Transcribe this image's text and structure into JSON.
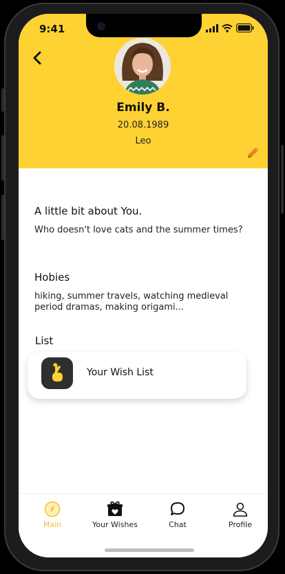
{
  "status_bar": {
    "time": "9:41"
  },
  "profile": {
    "name": "Emily B.",
    "dob": "20.08.1989",
    "sign": "Leo"
  },
  "about": {
    "title": "A little bit about You.",
    "text": "Who doesn't love cats and the summer times?"
  },
  "hobbies": {
    "title": "Hobies",
    "text": "hiking, summer travels, watching medieval period dramas, making origami..."
  },
  "list": {
    "title": "List",
    "wish_item": "Your Wish List"
  },
  "tabs": [
    {
      "label": "Main",
      "icon": "compass-icon"
    },
    {
      "label": "Your Wishes",
      "icon": "gift-icon"
    },
    {
      "label": "Chat",
      "icon": "chat-icon"
    },
    {
      "label": "Profile",
      "icon": "user-icon"
    }
  ],
  "colors": {
    "accent": "#FFD233",
    "active_tab": "#F2C230",
    "edit": "#E08A1E"
  }
}
